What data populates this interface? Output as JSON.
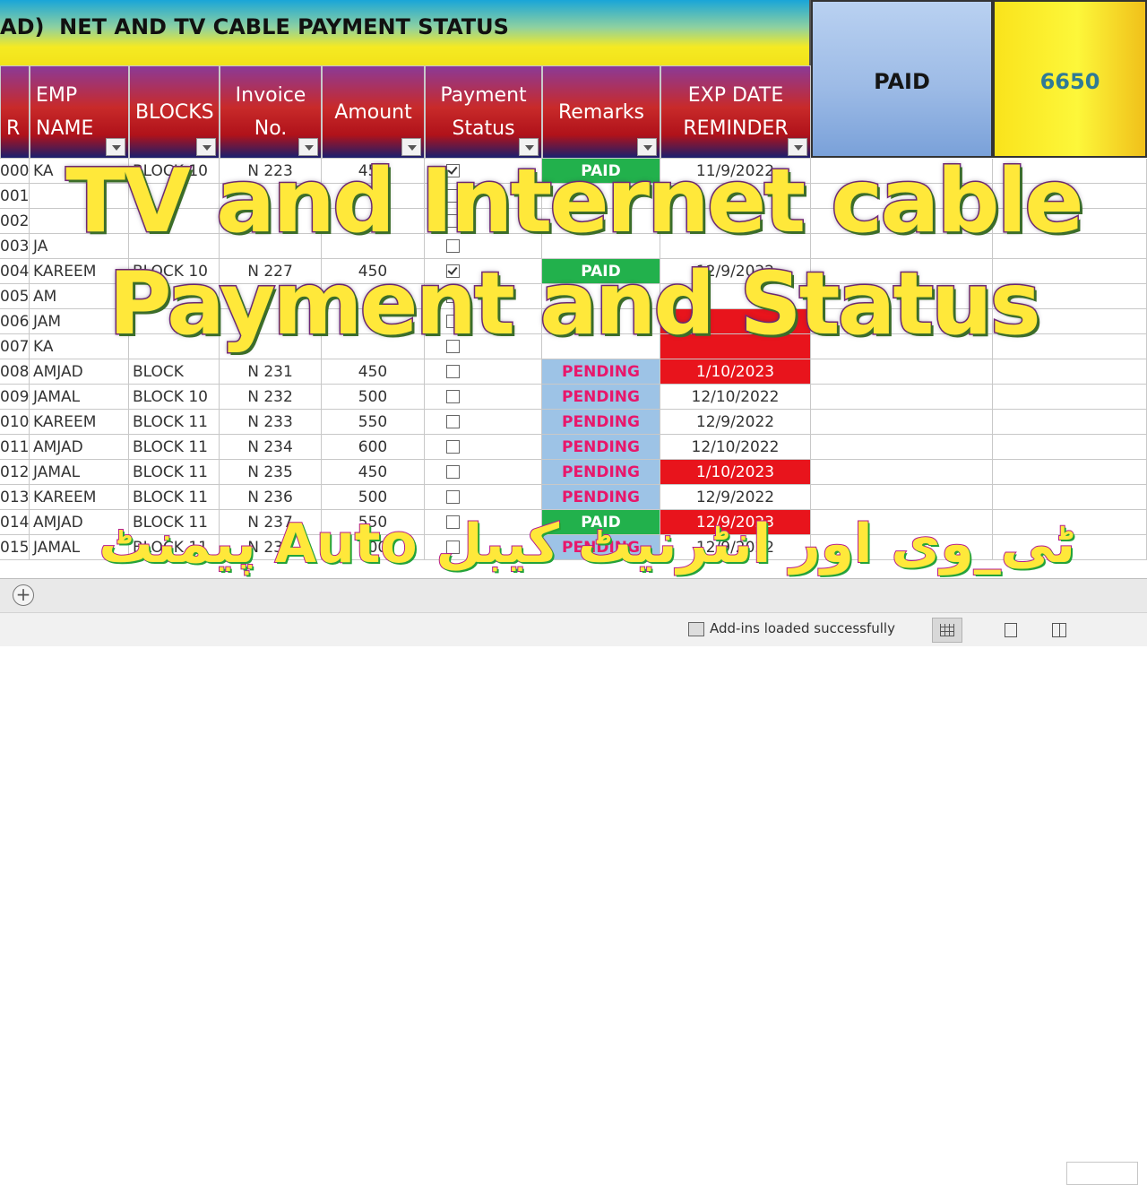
{
  "banner": {
    "title": "AD)  NET AND TV CABLE PAYMENT STATUS"
  },
  "summary": {
    "paid_label": "PAID",
    "paid_total": "6650"
  },
  "columns": [
    {
      "label": "R"
    },
    {
      "label": "EMP NAME"
    },
    {
      "label": "BLOCKS"
    },
    {
      "label": "Invoice No."
    },
    {
      "label": "Amount"
    },
    {
      "label": "Payment Status"
    },
    {
      "label": "Remarks"
    },
    {
      "label": "EXP DATE REMINDER"
    }
  ],
  "rows": [
    {
      "id": "000",
      "name": "KA",
      "block": "BLOCK 10",
      "invoice": "N 223",
      "amount": "450",
      "checked": true,
      "remark": "PAID",
      "date": "11/9/2022",
      "date_red": false
    },
    {
      "id": "001",
      "name": "",
      "block": "",
      "invoice": "",
      "amount": "",
      "checked": false,
      "remark": "",
      "date": "",
      "date_red": false
    },
    {
      "id": "002",
      "name": "",
      "block": "",
      "invoice": "",
      "amount": "",
      "checked": false,
      "remark": "",
      "date": "",
      "date_red": false
    },
    {
      "id": "003",
      "name": "JA",
      "block": "",
      "invoice": "",
      "amount": "",
      "checked": false,
      "remark": "",
      "date": "",
      "date_red": false
    },
    {
      "id": "004",
      "name": "KAREEM",
      "block": "BLOCK 10",
      "invoice": "N 227",
      "amount": "450",
      "checked": true,
      "remark": "PAID",
      "date": "12/9/2022",
      "date_red": false
    },
    {
      "id": "005",
      "name": "AM",
      "block": "",
      "invoice": "",
      "amount": "",
      "checked": false,
      "remark": "",
      "date": "",
      "date_red": false
    },
    {
      "id": "006",
      "name": "JAM",
      "block": "",
      "invoice": "",
      "amount": "",
      "checked": false,
      "remark": "",
      "date": "",
      "date_red": true
    },
    {
      "id": "007",
      "name": "KA",
      "block": "",
      "invoice": "",
      "amount": "",
      "checked": false,
      "remark": "",
      "date": "",
      "date_red": true
    },
    {
      "id": "008",
      "name": "AMJAD",
      "block": "BLOCK",
      "invoice": "N 231",
      "amount": "450",
      "checked": false,
      "remark": "PENDING",
      "date": "1/10/2023",
      "date_red": true
    },
    {
      "id": "009",
      "name": "JAMAL",
      "block": "BLOCK 10",
      "invoice": "N 232",
      "amount": "500",
      "checked": false,
      "remark": "PENDING",
      "date": "12/10/2022",
      "date_red": false
    },
    {
      "id": "010",
      "name": "KAREEM",
      "block": "BLOCK 11",
      "invoice": "N 233",
      "amount": "550",
      "checked": false,
      "remark": "PENDING",
      "date": "12/9/2022",
      "date_red": false
    },
    {
      "id": "011",
      "name": "AMJAD",
      "block": "BLOCK 11",
      "invoice": "N 234",
      "amount": "600",
      "checked": false,
      "remark": "PENDING",
      "date": "12/10/2022",
      "date_red": false
    },
    {
      "id": "012",
      "name": "JAMAL",
      "block": "BLOCK 11",
      "invoice": "N 235",
      "amount": "450",
      "checked": false,
      "remark": "PENDING",
      "date": "1/10/2023",
      "date_red": true
    },
    {
      "id": "013",
      "name": "KAREEM",
      "block": "BLOCK 11",
      "invoice": "N 236",
      "amount": "500",
      "checked": false,
      "remark": "PENDING",
      "date": "12/9/2022",
      "date_red": false
    },
    {
      "id": "014",
      "name": "AMJAD",
      "block": "BLOCK 11",
      "invoice": "N 237",
      "amount": "550",
      "checked": false,
      "remark": "PAID",
      "date": "12/9/2023",
      "date_red": true
    },
    {
      "id": "015",
      "name": "JAMAL",
      "block": "BLOCK 11",
      "invoice": "N 238",
      "amount": "600",
      "checked": false,
      "remark": "PENDING",
      "date": "12/9/2022",
      "date_red": false
    }
  ],
  "overlay": {
    "line1": "TV and Internet cable",
    "line2": "Payment and Status",
    "urdu": "ٹی_وی اور انٹرنیٹ کیبل Auto پیمنٹ"
  },
  "sheet_tabs": {
    "add_symbol": "+"
  },
  "status_bar": {
    "message": "Add-ins loaded successfully"
  },
  "colors": {
    "paid": "#22b14c",
    "pending_bg": "#9dc3e6",
    "pending_text": "#e8176b",
    "overdue": "#e8141c",
    "header": "#b0121a"
  }
}
